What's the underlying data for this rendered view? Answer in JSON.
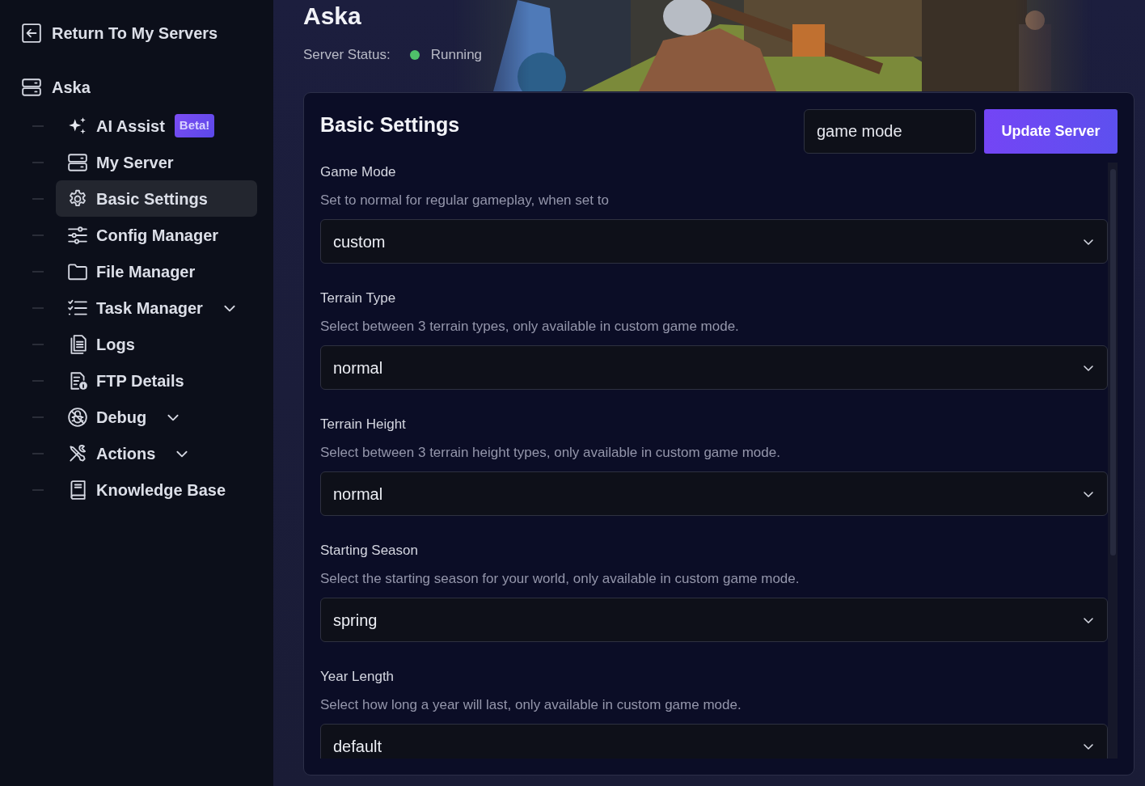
{
  "sidebar": {
    "back_link": "Return To My Servers",
    "server": "Aska",
    "items": [
      {
        "label": "AI Assist",
        "badge": "Beta!",
        "selected": false
      },
      {
        "label": "My Server",
        "selected": false
      },
      {
        "label": "Basic Settings",
        "selected": true
      },
      {
        "label": "Config Manager",
        "selected": false
      },
      {
        "label": "File Manager",
        "selected": false
      },
      {
        "label": "Task Manager",
        "expanded": false,
        "selected": false
      },
      {
        "label": "Logs",
        "selected": false
      },
      {
        "label": "FTP Details",
        "selected": false
      },
      {
        "label": "Debug",
        "expanded": false,
        "selected": false
      },
      {
        "label": "Actions",
        "expanded": false,
        "selected": false
      },
      {
        "label": "Knowledge Base",
        "selected": false
      }
    ]
  },
  "header": {
    "title": "Aska",
    "status_label": "Server Status:",
    "status": "Running",
    "online": true
  },
  "settings": {
    "title": "Basic Settings",
    "search": {
      "value": "game mode"
    },
    "update_button": "Update Server",
    "fields": [
      {
        "label": "Game Mode",
        "description": "Set to normal for regular gameplay, when set to",
        "value": "custom"
      },
      {
        "label": "Terrain Type",
        "description": "Select between 3 terrain types, only available in custom game mode.",
        "value": "normal"
      },
      {
        "label": "Terrain Height",
        "description": "Select between 3 terrain height types, only available in custom game mode.",
        "value": "normal"
      },
      {
        "label": "Starting Season",
        "description": "Select the starting season for your world, only available in custom game mode.",
        "value": "spring"
      },
      {
        "label": "Year Length",
        "description": "Select how long a year will last, only available in custom game mode.",
        "value": "default"
      }
    ]
  }
}
